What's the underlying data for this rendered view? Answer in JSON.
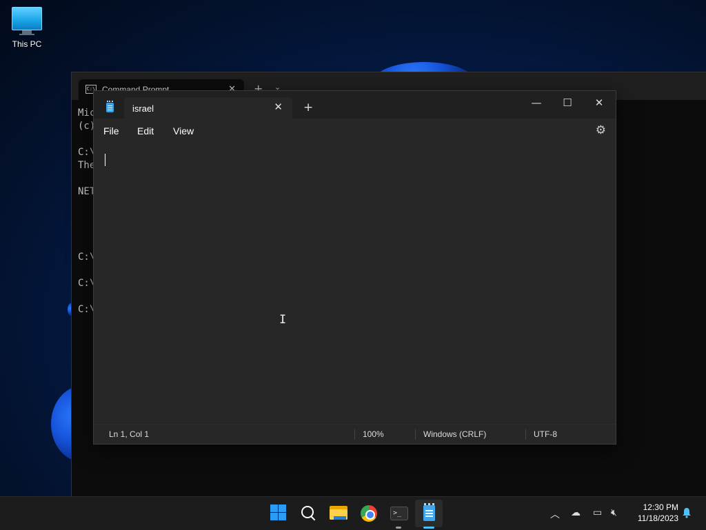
{
  "desktop": {
    "icons": [
      {
        "label": "This PC",
        "icon": "computer-monitor-icon"
      }
    ]
  },
  "cmd_window": {
    "tab_title": "Command Prompt",
    "tab_icon_text": "C:\\",
    "lines": [
      "Mic",
      "(c)",
      "",
      "C:\\",
      "The",
      "",
      "NET",
      "",
      "",
      "",
      "",
      "C:\\",
      "",
      "C:\\",
      "",
      "C:\\"
    ]
  },
  "notepad": {
    "tab_title": "israel",
    "menu": {
      "file": "File",
      "edit": "Edit",
      "view": "View"
    },
    "content": "",
    "status": {
      "position": "Ln 1, Col 1",
      "zoom": "100%",
      "line_ending": "Windows (CRLF)",
      "encoding": "UTF-8"
    }
  },
  "taskbar": {
    "apps": [
      "start-icon",
      "search-icon",
      "file-explorer-icon",
      "chrome-icon",
      "terminal-icon",
      "notepad-icon"
    ],
    "clock": {
      "time": "12:30 PM",
      "date": "11/18/2023"
    }
  },
  "colors": {
    "accent": "#2b9bf4",
    "notepad_bg": "#272727",
    "titlebar_bg": "#202020",
    "taskbar_bg": "#1c1c1c"
  }
}
